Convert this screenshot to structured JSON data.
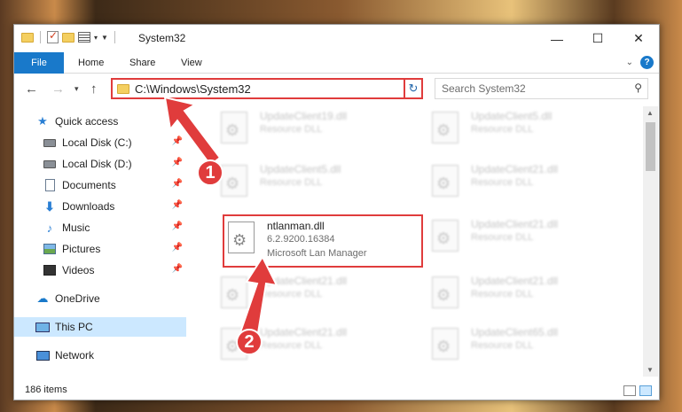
{
  "window": {
    "title": "System32",
    "controls": {
      "minimize": "—",
      "maximize": "☐",
      "close": "✕"
    }
  },
  "ribbon": {
    "tabs": [
      "File",
      "Home",
      "Share",
      "View"
    ]
  },
  "address": {
    "path": "C:\\Windows\\System32",
    "search_placeholder": "Search System32"
  },
  "sidebar": {
    "items": [
      {
        "label": "Quick access",
        "icon": "star-icon"
      },
      {
        "label": "Local Disk (C:)",
        "icon": "disk-icon",
        "pinned": true
      },
      {
        "label": "Local Disk (D:)",
        "icon": "disk-icon",
        "pinned": true
      },
      {
        "label": "Documents",
        "icon": "document-icon",
        "pinned": true
      },
      {
        "label": "Downloads",
        "icon": "download-icon",
        "pinned": true
      },
      {
        "label": "Music",
        "icon": "music-icon",
        "pinned": true
      },
      {
        "label": "Pictures",
        "icon": "pictures-icon",
        "pinned": true
      },
      {
        "label": "Videos",
        "icon": "videos-icon",
        "pinned": true
      },
      {
        "label": "OneDrive",
        "icon": "cloud-icon"
      },
      {
        "label": "This PC",
        "icon": "pc-icon",
        "selected": true
      },
      {
        "label": "Network",
        "icon": "network-icon"
      }
    ]
  },
  "files": [
    {
      "name": "UpdateClient19.dll",
      "desc": "Resource DLL"
    },
    {
      "name": "UpdateClient5.dll",
      "desc": "Resource DLL"
    },
    {
      "name": "UpdateClient5.dll",
      "desc": "Resource DLL"
    },
    {
      "name": "UpdateClient21.dll",
      "desc": "Resource DLL"
    },
    {
      "name": "ntlanman.dll",
      "desc": "6.2.9200.16384",
      "company": "Microsoft Lan Manager"
    },
    {
      "name": "UpdateClient21.dll",
      "desc": "Resource DLL"
    },
    {
      "name": "UpdateClient21.dll",
      "desc": "Resource DLL"
    },
    {
      "name": "UpdateClient21.dll",
      "desc": "Resource DLL"
    },
    {
      "name": "UpdateClient21.dll",
      "desc": "Resource DLL"
    },
    {
      "name": "UpdateClient65.dll",
      "desc": "Resource DLL"
    }
  ],
  "status": {
    "item_count": "186 items"
  },
  "annotations": {
    "step1": "1",
    "step2": "2",
    "color": "#e03c3c"
  }
}
